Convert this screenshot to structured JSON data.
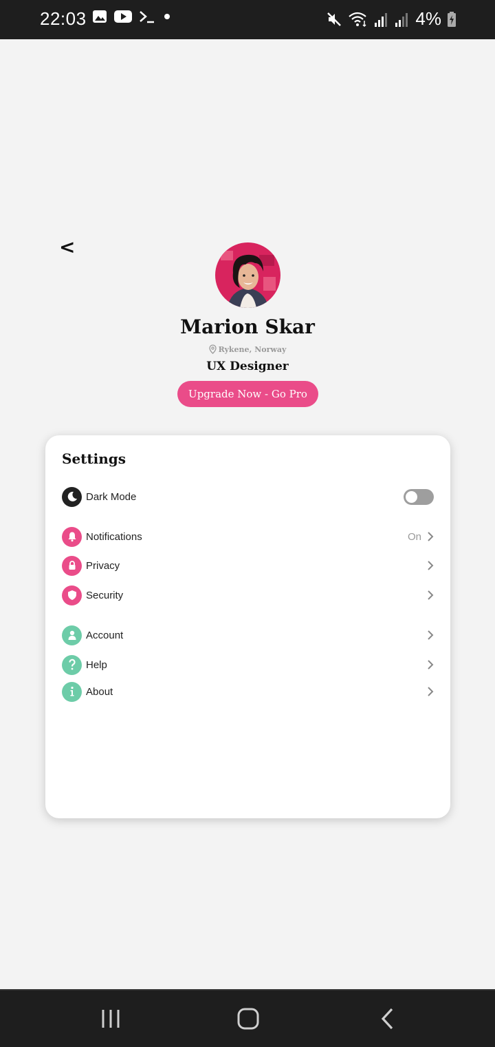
{
  "status_bar": {
    "time": "22:03",
    "battery": "4%",
    "icons": [
      "image-icon",
      "youtube-icon",
      "terminal-icon",
      "dot-icon",
      "mute-icon",
      "wifi-icon",
      "signal-icon",
      "signal-icon",
      "battery-charging-icon"
    ]
  },
  "profile": {
    "back_label": "<",
    "name": "Marion Skar",
    "location": "Rykene, Norway",
    "role": "UX Designer",
    "upgrade_label": "Upgrade Now - Go Pro"
  },
  "settings": {
    "title": "Settings",
    "dark_mode": {
      "label": "Dark Mode",
      "icon": "moon-icon",
      "enabled": false
    },
    "items": [
      {
        "label": "Notifications",
        "value": "On",
        "icon": "bell-icon"
      },
      {
        "label": "Privacy",
        "value": "",
        "icon": "lock-icon"
      },
      {
        "label": "Security",
        "value": "",
        "icon": "shield-icon"
      },
      {
        "label": "Account",
        "value": "",
        "icon": "user-icon"
      },
      {
        "label": "Help",
        "value": "",
        "icon": "question-icon"
      },
      {
        "label": "About",
        "value": "",
        "icon": "info-icon"
      }
    ]
  },
  "colors": {
    "accent": "#ea4c89",
    "teal": "#6dcca8",
    "background": "#f3f3f3",
    "system_bar": "#1e1e1e"
  }
}
